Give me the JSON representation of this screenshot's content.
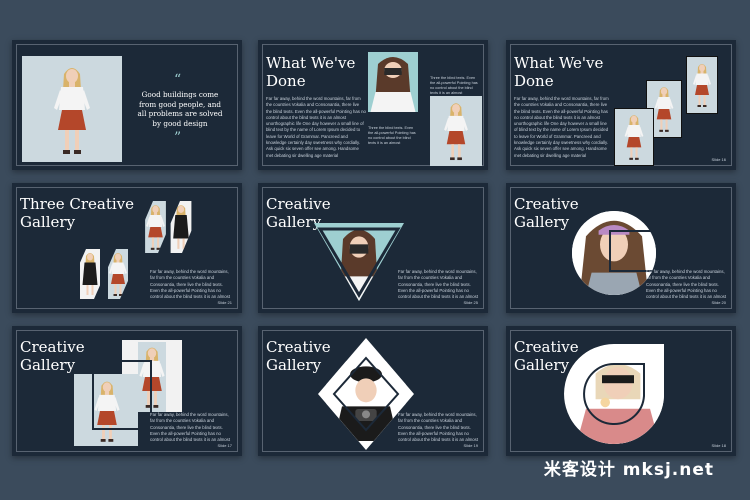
{
  "colors": {
    "background": "#3b4b5c",
    "slide": "#1c2938",
    "accent_teal": "#9ecfd1",
    "skirt_red": "#b4472a"
  },
  "slide1": {
    "quote_open": "“",
    "quote": "Good buildings come from good people, and all problems are solved by good design",
    "quote_close": "”"
  },
  "slide2": {
    "title": "What We've\nDone",
    "body": "Far far away, behind the word mountains, far from the countries Vokalia and Consonantia, there live the blind texts. Even the all-powerful Pointing has no control about the blind texts it is an almost unorthographic life One day however a small line of blind text by the name of Lorem Ipsum decided to leave for World of Grammar. Pancreed and knowledge certainly day sweetness why cordially. Ask quick six seven offer see among. Handsome met debating sir dwelling age material",
    "caption_right": "Three the blind texts. Even the all-powerful Pointing has no control about the blind texts it is an almost",
    "caption_left": "Three the blind texts. Even the all-powerful Pointing has no control about the blind texts it is an almost"
  },
  "slide3": {
    "title": "What We've\nDone",
    "body": "Far far away, behind the word mountains, far from the countries Vokalia and Consonantia, there live the blind texts. Even the all-powerful Pointing has no control about the blind texts it is an almost unorthographic life One day however a small line of blind text by the name of Lorem Ipsum decided to leave for World of Grammar. Pancreed and knowledge certainly day sweetness why cordially. Ask quick six seven offer see among. Handsome met debating sir dwelling age material",
    "slide_num": "Slide 16"
  },
  "slide4": {
    "title": "Three Creative\nGallery",
    "body": "Far far away, behind the word mountains, far from the countries Vokalia and Consonantia, there live the blind texts. Even the all-powerful Pointing has no control about the blind texts it is an almost",
    "slide_num": "Slide 21"
  },
  "slide5": {
    "title": "Creative\nGallery",
    "body": "Far far away, behind the word mountains, far from the countries Vokalia and Consonantia, there live the blind texts. Even the all-powerful Pointing has no control about the blind texts it is an almost",
    "slide_num": "Slide 25"
  },
  "slide6": {
    "title": "Creative\nGallery",
    "body": "Far far away, behind the word mountains, far from the countries Vokalia and Consonantia, there live the blind texts. Even the all-powerful Pointing has no control about the blind texts it is an almost",
    "slide_num": "Slide 20"
  },
  "slide7": {
    "title": "Creative\nGallery",
    "body": "Far far away, behind the word mountains, far from the countries Vokalia and Consonantia, there live the blind texts. Even the all-powerful Pointing has no control about the blind texts it is an almost",
    "slide_num": "Slide 17"
  },
  "slide8": {
    "title": "Creative\nGallery",
    "body": "Far far away, behind the word mountains, far from the countries Vokalia and Consonantia, there live the blind texts. Even the all-powerful Pointing has no control about the blind texts it is an almost",
    "slide_num": "Slide 19"
  },
  "slide9": {
    "title": "Creative\nGallery",
    "body": "Far far away, behind the word mountains, far from the countries Vokalia and Consonantia, there live the blind texts. Even the all-powerful Pointing has no control about the blind texts it is an almost",
    "slide_num": "Slide 18"
  },
  "watermark": "米客设计 mksj.net"
}
